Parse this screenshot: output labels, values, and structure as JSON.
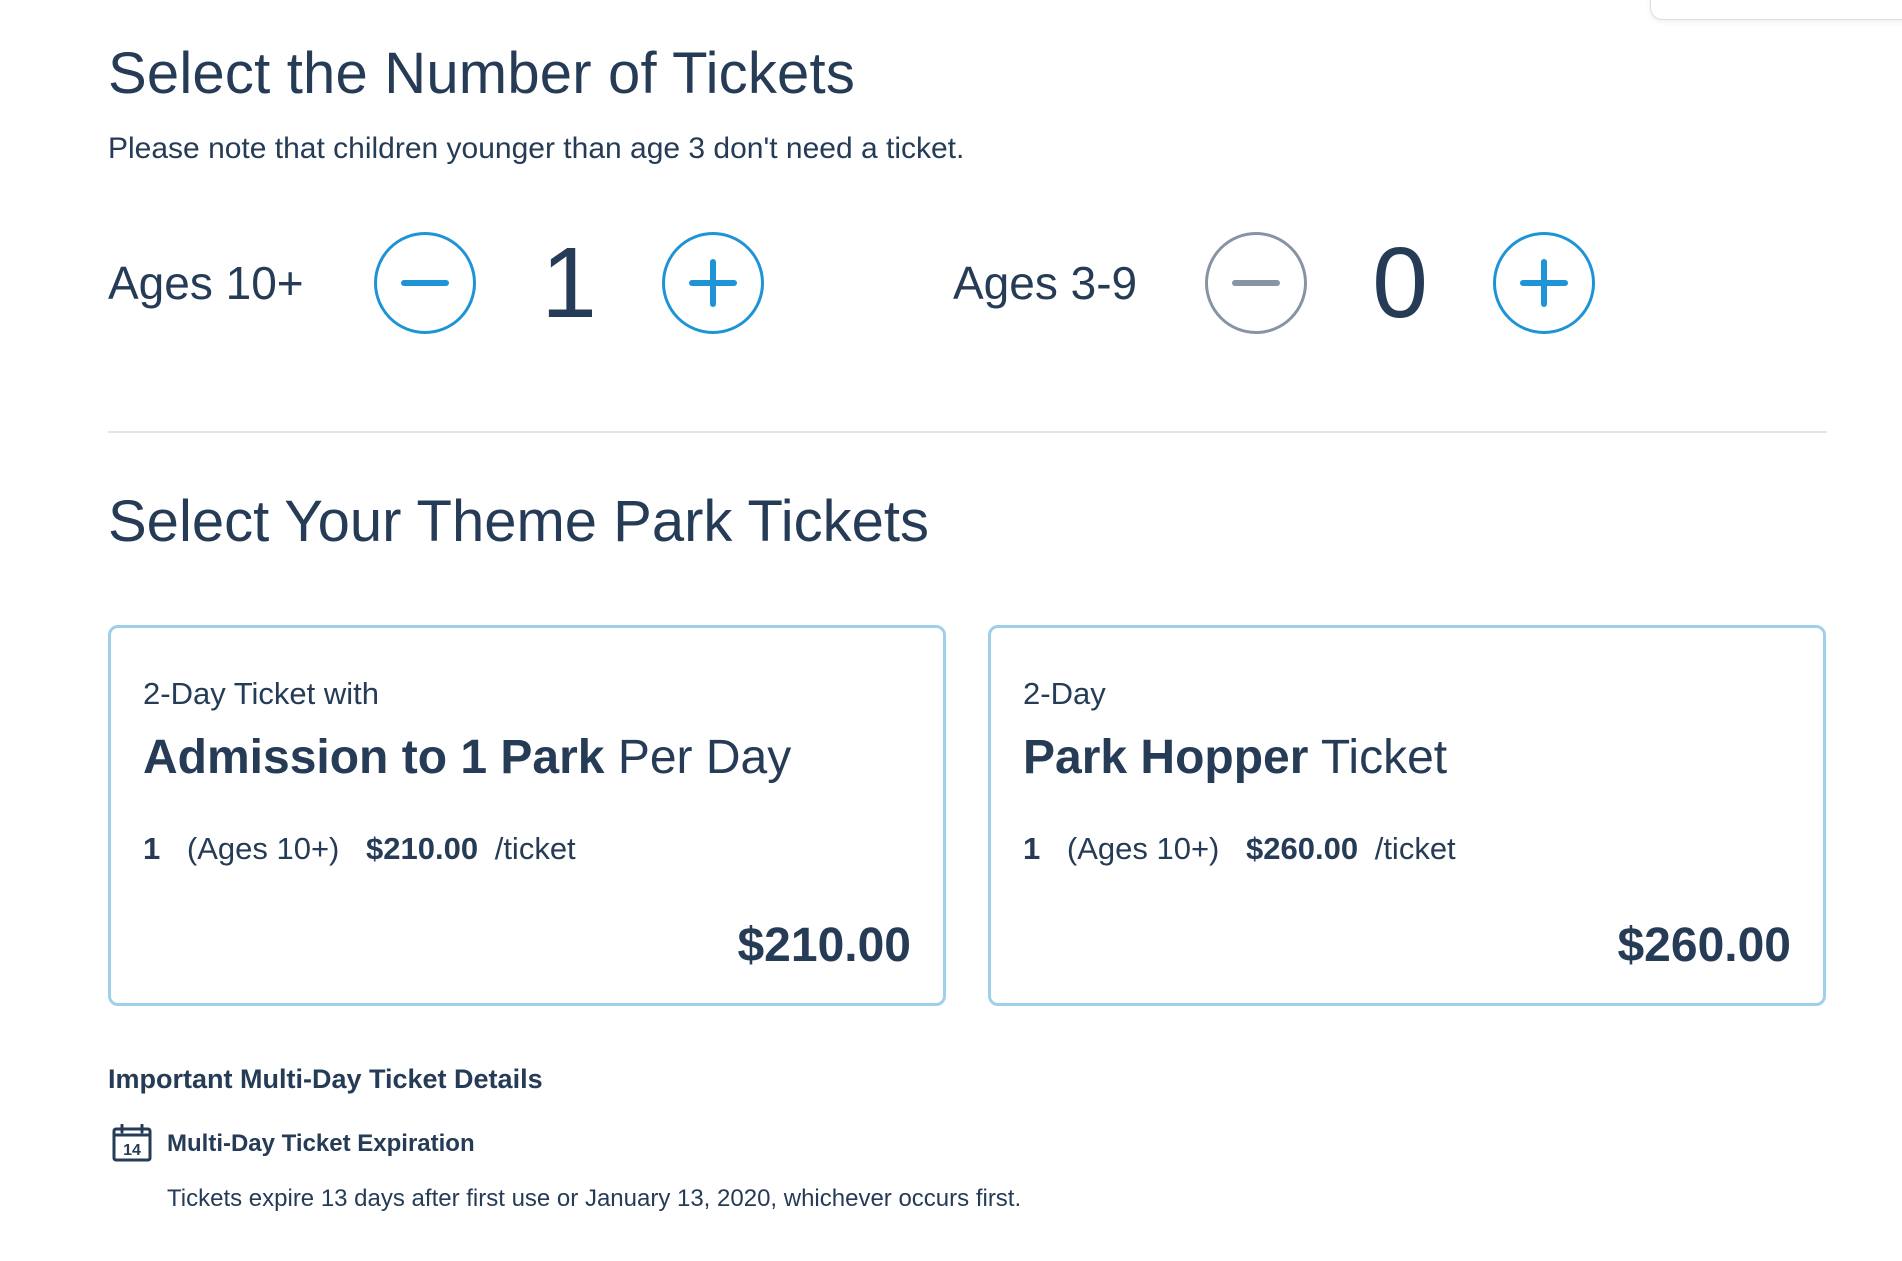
{
  "header": {
    "title": "Select the Number of Tickets",
    "note": "Please note that children younger than age 3 don't need a ticket."
  },
  "selectors": {
    "adult": {
      "label": "Ages 10+",
      "count": "1",
      "decrement_icon": "minus-icon",
      "increment_icon": "plus-icon",
      "decrement_enabled": true
    },
    "child": {
      "label": "Ages 3-9",
      "count": "0",
      "decrement_icon": "minus-icon",
      "increment_icon": "plus-icon",
      "decrement_enabled": false
    }
  },
  "tickets_section": {
    "title": "Select Your Theme Park Tickets",
    "cards": [
      {
        "subtitle": "2-Day Ticket with",
        "title_bold": "Admission to 1 Park",
        "title_light": "Per Day",
        "qty": "1",
        "age": "(Ages 10+)",
        "price": "$210.00",
        "unit": "/ticket",
        "total": "$210.00"
      },
      {
        "subtitle": "2-Day",
        "title_bold": "Park Hopper",
        "title_light": "Ticket",
        "qty": "1",
        "age": "(Ages 10+)",
        "price": "$260.00",
        "unit": "/ticket",
        "total": "$260.00"
      }
    ]
  },
  "details": {
    "heading": "Important Multi-Day Ticket Details",
    "calendar_number": "14",
    "calendar_icon": "calendar-icon",
    "expiration_title": "Multi-Day Ticket Expiration",
    "expiration_text": "Tickets expire 13 days after first use or January 13, 2020, whichever occurs first."
  },
  "colors": {
    "text": "#253b56",
    "accent": "#1e93d6",
    "disabled": "#8794a3",
    "card_border": "#9ed0ec",
    "divider": "#e1e4e8"
  }
}
